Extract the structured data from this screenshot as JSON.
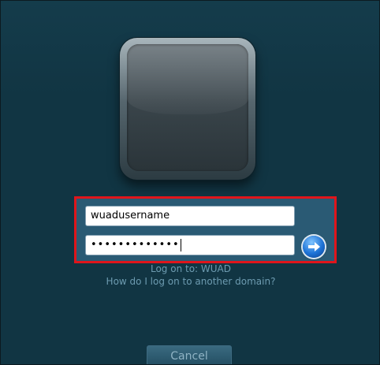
{
  "login": {
    "username_value": "wuadusername",
    "password_masked": "•••••••••••••",
    "logon_to_text": "Log on to: WUAD",
    "domain_link_text": "How do I log on to another domain?",
    "cancel_label": "Cancel",
    "submit_icon": "arrow-right-icon",
    "user_tile_icon": "user-picture-tile"
  },
  "colors": {
    "background": "#113543",
    "highlight_border": "#e0151b",
    "panel": "#2a5a74",
    "submit_button": "#1d72d6"
  }
}
